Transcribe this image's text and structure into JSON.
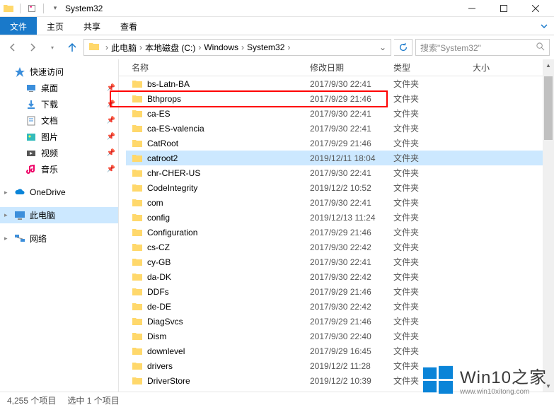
{
  "window": {
    "title": "System32"
  },
  "ribbon": {
    "file": "文件",
    "tabs": [
      "主页",
      "共享",
      "查看"
    ]
  },
  "breadcrumb": {
    "items": [
      "此电脑",
      "本地磁盘 (C:)",
      "Windows",
      "System32"
    ]
  },
  "search": {
    "placeholder": "搜索\"System32\""
  },
  "sidebar": {
    "quick": {
      "label": "快速访问"
    },
    "quick_items": [
      {
        "label": "桌面",
        "icon": "desktop"
      },
      {
        "label": "下载",
        "icon": "download"
      },
      {
        "label": "文档",
        "icon": "document"
      },
      {
        "label": "图片",
        "icon": "picture"
      },
      {
        "label": "视频",
        "icon": "video"
      },
      {
        "label": "音乐",
        "icon": "music"
      }
    ],
    "onedrive": {
      "label": "OneDrive"
    },
    "thispc": {
      "label": "此电脑"
    },
    "network": {
      "label": "网络"
    }
  },
  "columns": {
    "name": "名称",
    "date": "修改日期",
    "type": "类型",
    "size": "大小"
  },
  "files": [
    {
      "name": "bs-Latn-BA",
      "date": "2017/9/30 22:41",
      "type": "文件夹"
    },
    {
      "name": "Bthprops",
      "date": "2017/9/29 21:46",
      "type": "文件夹"
    },
    {
      "name": "ca-ES",
      "date": "2017/9/30 22:41",
      "type": "文件夹"
    },
    {
      "name": "ca-ES-valencia",
      "date": "2017/9/30 22:41",
      "type": "文件夹"
    },
    {
      "name": "CatRoot",
      "date": "2017/9/29 21:46",
      "type": "文件夹"
    },
    {
      "name": "catroot2",
      "date": "2019/12/11 18:04",
      "type": "文件夹",
      "selected": true
    },
    {
      "name": "chr-CHER-US",
      "date": "2017/9/30 22:41",
      "type": "文件夹"
    },
    {
      "name": "CodeIntegrity",
      "date": "2019/12/2 10:52",
      "type": "文件夹"
    },
    {
      "name": "com",
      "date": "2017/9/30 22:41",
      "type": "文件夹"
    },
    {
      "name": "config",
      "date": "2019/12/13 11:24",
      "type": "文件夹"
    },
    {
      "name": "Configuration",
      "date": "2017/9/29 21:46",
      "type": "文件夹"
    },
    {
      "name": "cs-CZ",
      "date": "2017/9/30 22:42",
      "type": "文件夹"
    },
    {
      "name": "cy-GB",
      "date": "2017/9/30 22:41",
      "type": "文件夹"
    },
    {
      "name": "da-DK",
      "date": "2017/9/30 22:42",
      "type": "文件夹"
    },
    {
      "name": "DDFs",
      "date": "2017/9/29 21:46",
      "type": "文件夹"
    },
    {
      "name": "de-DE",
      "date": "2017/9/30 22:42",
      "type": "文件夹"
    },
    {
      "name": "DiagSvcs",
      "date": "2017/9/29 21:46",
      "type": "文件夹"
    },
    {
      "name": "Dism",
      "date": "2017/9/30 22:40",
      "type": "文件夹"
    },
    {
      "name": "downlevel",
      "date": "2017/9/29 16:45",
      "type": "文件夹"
    },
    {
      "name": "drivers",
      "date": "2019/12/2 11:28",
      "type": "文件夹"
    },
    {
      "name": "DriverStore",
      "date": "2019/12/2 10:39",
      "type": "文件夹"
    }
  ],
  "status": {
    "count": "4,255 个项目",
    "selected": "选中 1 个项目"
  },
  "watermark": {
    "main": "Win10之家",
    "sub": "www.win10xitong.com"
  }
}
